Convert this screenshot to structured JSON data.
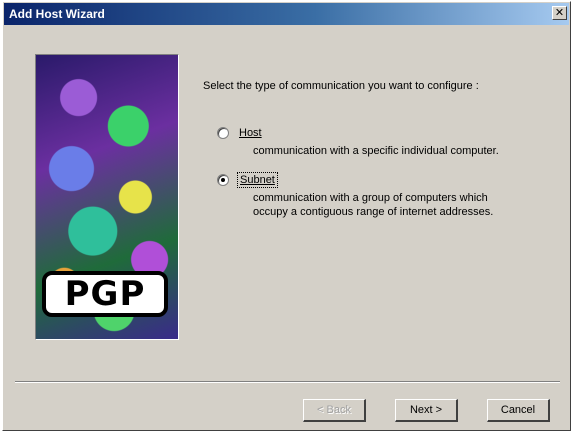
{
  "window": {
    "title": "Add Host Wizard",
    "close_glyph": "✕"
  },
  "side_image": {
    "logo_text": "PGP",
    "icon": "pgp-artwork"
  },
  "content": {
    "instruction": "Select the type of communication you want to configure :",
    "options": [
      {
        "label": "Host",
        "selected": false,
        "description_lines": [
          "communication with a specific individual computer."
        ]
      },
      {
        "label": "Subnet",
        "selected": true,
        "description_lines": [
          "communication with a group of computers which",
          "occupy a contiguous range of internet addresses."
        ]
      }
    ]
  },
  "buttons": {
    "back": "< Back",
    "next": "Next >",
    "cancel": "Cancel"
  }
}
